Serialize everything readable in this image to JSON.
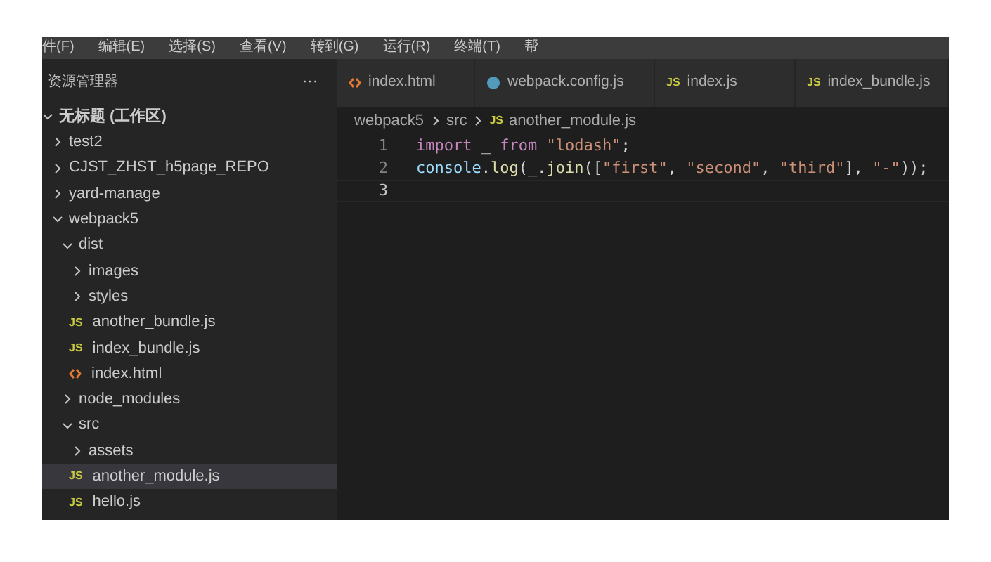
{
  "menu_bar": [
    "件(F)",
    "编辑(E)",
    "选择(S)",
    "查看(V)",
    "转到(G)",
    "运行(R)",
    "终端(T)",
    "帮"
  ],
  "sidebar": {
    "title": "资源管理器",
    "more": "···",
    "tree": [
      {
        "kind": "folder",
        "label": "无标题 (工作区)",
        "expanded": true,
        "selected": false,
        "bold": true,
        "children": [
          {
            "kind": "folder",
            "label": "test2",
            "expanded": false,
            "selected": false
          },
          {
            "kind": "folder",
            "label": "CJST_ZHST_h5page_REPO",
            "expanded": false,
            "selected": false
          },
          {
            "kind": "folder",
            "label": "yard-manage",
            "expanded": false,
            "selected": false
          },
          {
            "kind": "folder",
            "label": "webpack5",
            "expanded": true,
            "selected": false,
            "children": [
              {
                "kind": "folder",
                "label": "dist",
                "expanded": true,
                "selected": false,
                "children": [
                  {
                    "kind": "folder",
                    "label": "images",
                    "expanded": false,
                    "selected": false
                  },
                  {
                    "kind": "folder",
                    "label": "styles",
                    "expanded": false,
                    "selected": false
                  },
                  {
                    "kind": "js",
                    "icon_label": "JS",
                    "label": "another_bundle.js",
                    "selected": false
                  },
                  {
                    "kind": "js",
                    "icon_label": "JS",
                    "label": "index_bundle.js",
                    "selected": false
                  },
                  {
                    "kind": "html",
                    "label": "index.html",
                    "selected": false
                  }
                ]
              },
              {
                "kind": "folder",
                "label": "node_modules",
                "expanded": false,
                "selected": false
              },
              {
                "kind": "folder",
                "label": "src",
                "expanded": true,
                "selected": false,
                "children": [
                  {
                    "kind": "folder",
                    "label": "assets",
                    "expanded": false,
                    "selected": false
                  },
                  {
                    "kind": "js",
                    "icon_label": "JS",
                    "label": "another_module.js",
                    "selected": true
                  },
                  {
                    "kind": "js",
                    "icon_label": "JS",
                    "label": "hello.js",
                    "selected": false
                  }
                ]
              }
            ]
          }
        ]
      }
    ]
  },
  "tabs": [
    {
      "kind": "html",
      "label": "index.html",
      "selected": false
    },
    {
      "kind": "config",
      "label": "webpack.config.js",
      "selected": false
    },
    {
      "kind": "js",
      "icon_label": "JS",
      "label": "index.js",
      "selected": false
    },
    {
      "kind": "js",
      "icon_label": "JS",
      "label": "index_bundle.js",
      "selected": false
    }
  ],
  "breadcrumb": [
    {
      "kind": "folder",
      "label": "webpack5"
    },
    {
      "kind": "folder",
      "label": "src"
    },
    {
      "kind": "js",
      "icon_label": "JS",
      "label": "another_module.js"
    }
  ],
  "editor": {
    "lines": [
      {
        "number": "1",
        "active": false,
        "tokens": [
          {
            "kind": "keyword",
            "text": "import"
          },
          {
            "kind": "plain",
            "text": " _ "
          },
          {
            "kind": "keyword",
            "text": "from"
          },
          {
            "kind": "string",
            "text": " \"lodash\""
          },
          {
            "kind": "plain",
            "text": ";"
          }
        ]
      },
      {
        "number": "2",
        "active": false,
        "tokens": [
          {
            "kind": "variable",
            "text": "console"
          },
          {
            "kind": "plain",
            "text": "."
          },
          {
            "kind": "function",
            "text": "log"
          },
          {
            "kind": "plain",
            "text": "(_."
          },
          {
            "kind": "function",
            "text": "join"
          },
          {
            "kind": "plain",
            "text": "(["
          },
          {
            "kind": "string",
            "text": "\"first\""
          },
          {
            "kind": "plain",
            "text": ", "
          },
          {
            "kind": "string",
            "text": "\"second\""
          },
          {
            "kind": "plain",
            "text": ", "
          },
          {
            "kind": "string",
            "text": "\"third\""
          },
          {
            "kind": "plain",
            "text": "], "
          },
          {
            "kind": "string",
            "text": "\"-\""
          },
          {
            "kind": "plain",
            "text": "));"
          }
        ]
      },
      {
        "number": "3",
        "active": true
      }
    ]
  }
}
